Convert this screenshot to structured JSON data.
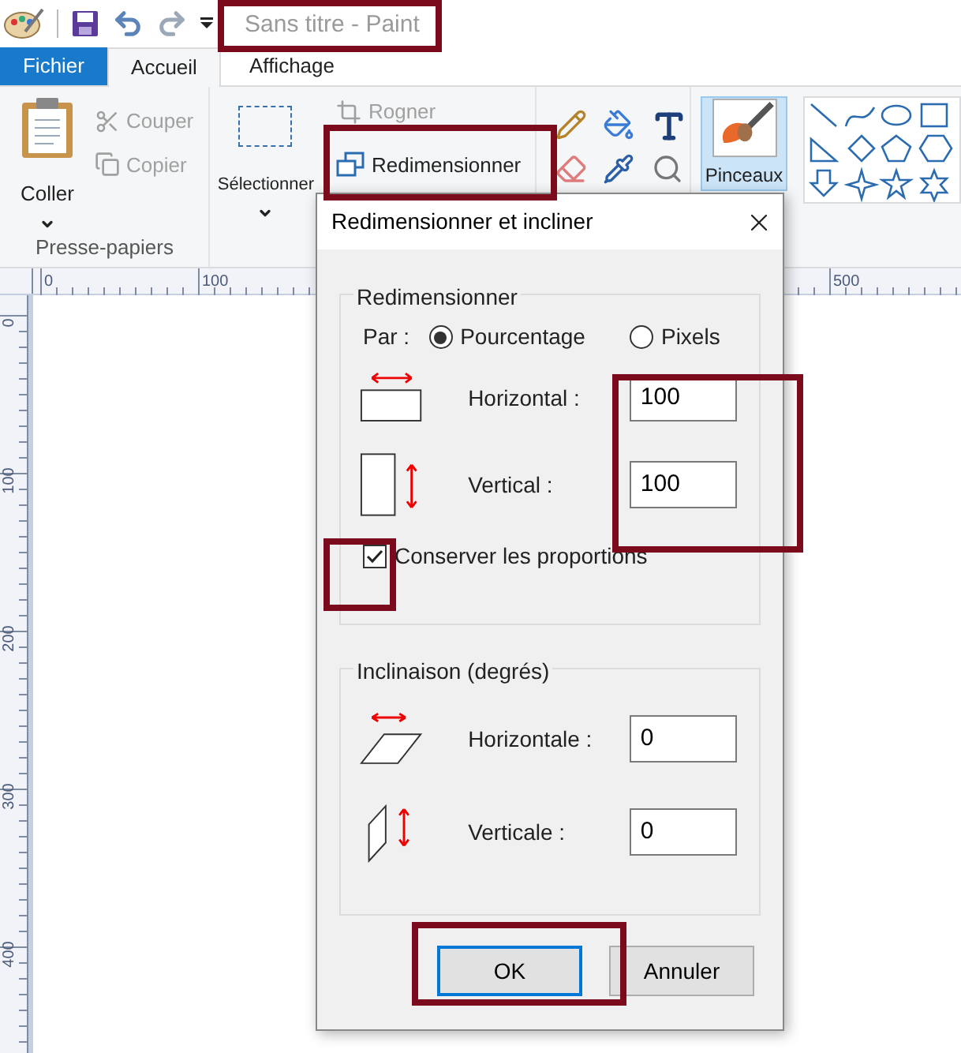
{
  "window": {
    "title": "Sans titre - Paint"
  },
  "tabs": [
    {
      "label": "Fichier",
      "kind": "file",
      "selected": false
    },
    {
      "label": "Accueil",
      "kind": "tab",
      "selected": true
    },
    {
      "label": "Affichage",
      "kind": "tab",
      "selected": false
    }
  ],
  "ribbon": {
    "clipboard": {
      "paste": "Coller",
      "cut": {
        "label": "Couper",
        "disabled": true
      },
      "copy": {
        "label": "Copier",
        "disabled": true
      },
      "group_label": "Presse-papiers"
    },
    "image": {
      "select": "Sélectionner",
      "crop": {
        "label": "Rogner",
        "disabled": true
      },
      "resize": {
        "label": "Redimensionner",
        "disabled": false
      }
    },
    "brushes": {
      "label": "Pinceaux",
      "selected": true
    }
  },
  "rulers": {
    "horizontal": [
      "0",
      "100",
      "500"
    ],
    "vertical": [
      "0",
      "100",
      "200",
      "300",
      "400"
    ]
  },
  "dialog": {
    "title": "Redimensionner et incliner",
    "resize": {
      "legend": "Redimensionner",
      "by_label": "Par :",
      "by": [
        {
          "label": "Pourcentage",
          "selected": true
        },
        {
          "label": "Pixels",
          "selected": false
        }
      ],
      "horizontal": {
        "label": "Horizontal :",
        "value": "100"
      },
      "vertical": {
        "label": "Vertical :",
        "value": "100"
      },
      "keep_ratio": {
        "label": "Conserver les proportions",
        "checked": true
      }
    },
    "skew": {
      "legend": "Inclinaison (degrés)",
      "horizontal": {
        "label": "Horizontale :",
        "value": "0"
      },
      "vertical": {
        "label": "Verticale :",
        "value": "0"
      }
    },
    "buttons": [
      {
        "label": "OK",
        "default": true
      },
      {
        "label": "Annuler",
        "default": false
      }
    ]
  }
}
